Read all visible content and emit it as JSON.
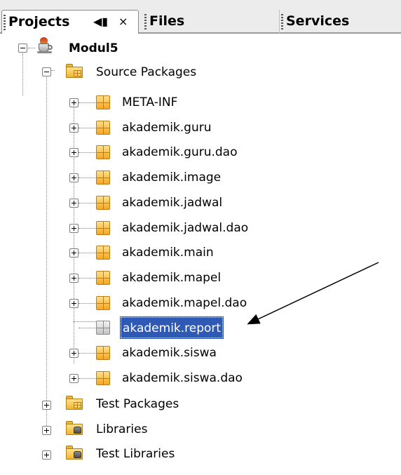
{
  "tabs": {
    "projects": {
      "label": "Projects",
      "minimize_icon": "◀▮",
      "close_icon": "×"
    },
    "files": {
      "label": "Files"
    },
    "services": {
      "label": "Services"
    }
  },
  "tree": {
    "project": {
      "label": "Modul5",
      "icon": "project-cup-icon"
    },
    "source_packages": {
      "label": "Source Packages",
      "packages": [
        "META-INF",
        "akademik.guru",
        "akademik.guru.dao",
        "akademik.image",
        "akademik.jadwal",
        "akademik.jadwal.dao",
        "akademik.main",
        "akademik.mapel",
        "akademik.mapel.dao",
        "akademik.report",
        "akademik.siswa",
        "akademik.siswa.dao"
      ],
      "selected": "akademik.report"
    },
    "test_packages": {
      "label": "Test Packages"
    },
    "libraries": {
      "label": "Libraries"
    },
    "test_libraries": {
      "label": "Test Libraries"
    }
  },
  "colors": {
    "selection": "#2e59b5",
    "package": "#f4a623",
    "empty_package": "#c4c4c4"
  }
}
